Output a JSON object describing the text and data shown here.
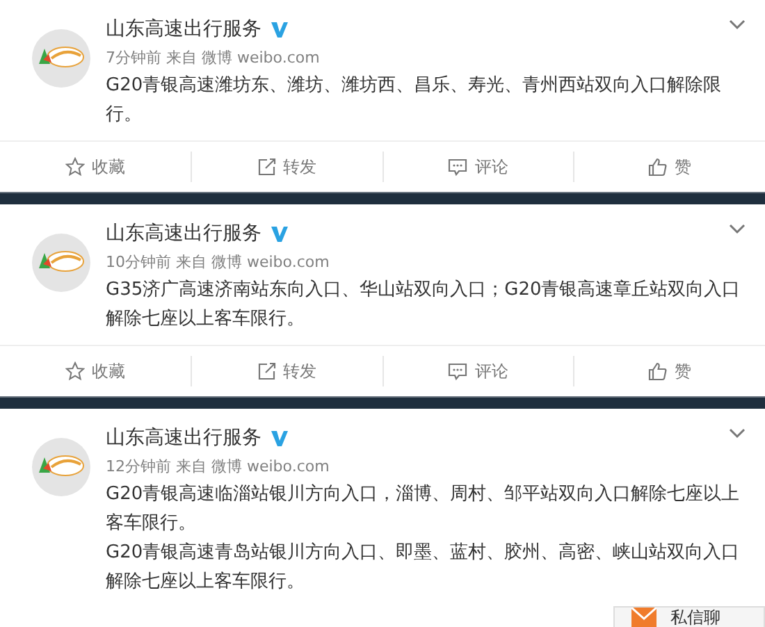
{
  "posts": [
    {
      "author": "山东高速出行服务",
      "verified": true,
      "meta": "7分钟前 来自 微博 weibo.com",
      "paragraphs": [
        "G20青银高速潍坊东、潍坊、潍坊西、昌乐、寿光、青州西站双向入口解除限行。"
      ],
      "actions": [
        {
          "kind": "star",
          "label": "收藏"
        },
        {
          "kind": "share",
          "label": "转发"
        },
        {
          "kind": "comment",
          "label": "评论"
        },
        {
          "kind": "like",
          "label": "赞"
        }
      ]
    },
    {
      "author": "山东高速出行服务",
      "verified": true,
      "meta": "10分钟前 来自 微博 weibo.com",
      "paragraphs": [
        "G35济广高速济南站东向入口、华山站双向入口；G20青银高速章丘站双向入口解除七座以上客车限行。"
      ],
      "actions": [
        {
          "kind": "star",
          "label": "收藏"
        },
        {
          "kind": "share",
          "label": "转发"
        },
        {
          "kind": "comment",
          "label": "评论"
        },
        {
          "kind": "like",
          "label": "赞"
        }
      ]
    },
    {
      "author": "山东高速出行服务",
      "verified": true,
      "meta": "12分钟前 来自 微博 weibo.com",
      "paragraphs": [
        "G20青银高速临淄站银川方向入口，淄博、周村、邹平站双向入口解除七座以上客车限行。",
        "G20青银高速青岛站银川方向入口、即墨、蓝村、胶州、高密、峡山站双向入口解除七座以上客车限行。"
      ]
    }
  ],
  "chat_popup": {
    "label": "私信聊"
  }
}
